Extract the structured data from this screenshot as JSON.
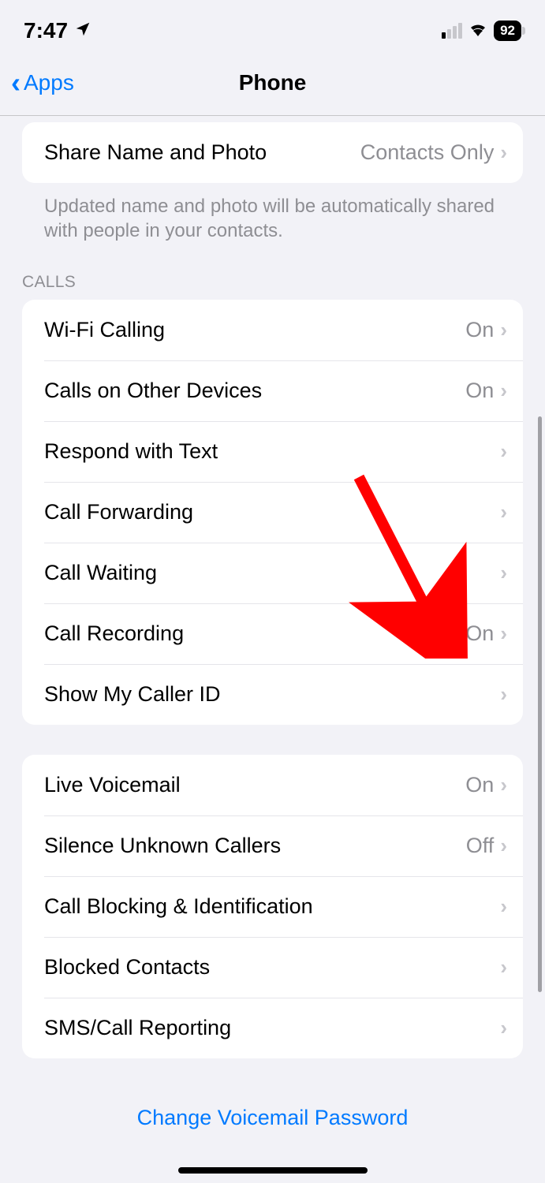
{
  "status": {
    "time": "7:47",
    "battery": "92"
  },
  "nav": {
    "back_label": "Apps",
    "title": "Phone"
  },
  "share_section": {
    "items": [
      {
        "label": "Share Name and Photo",
        "value": "Contacts Only"
      }
    ],
    "footer": "Updated name and photo will be automatically shared with people in your contacts."
  },
  "calls_section": {
    "header": "CALLS",
    "items": [
      {
        "label": "Wi-Fi Calling",
        "value": "On"
      },
      {
        "label": "Calls on Other Devices",
        "value": "On"
      },
      {
        "label": "Respond with Text",
        "value": ""
      },
      {
        "label": "Call Forwarding",
        "value": ""
      },
      {
        "label": "Call Waiting",
        "value": ""
      },
      {
        "label": "Call Recording",
        "value": "On"
      },
      {
        "label": "Show My Caller ID",
        "value": ""
      }
    ]
  },
  "lower_section": {
    "items": [
      {
        "label": "Live Voicemail",
        "value": "On"
      },
      {
        "label": "Silence Unknown Callers",
        "value": "Off"
      },
      {
        "label": "Call Blocking & Identification",
        "value": ""
      },
      {
        "label": "Blocked Contacts",
        "value": ""
      },
      {
        "label": "SMS/Call Reporting",
        "value": ""
      }
    ]
  },
  "voicemail_link": "Change Voicemail Password"
}
